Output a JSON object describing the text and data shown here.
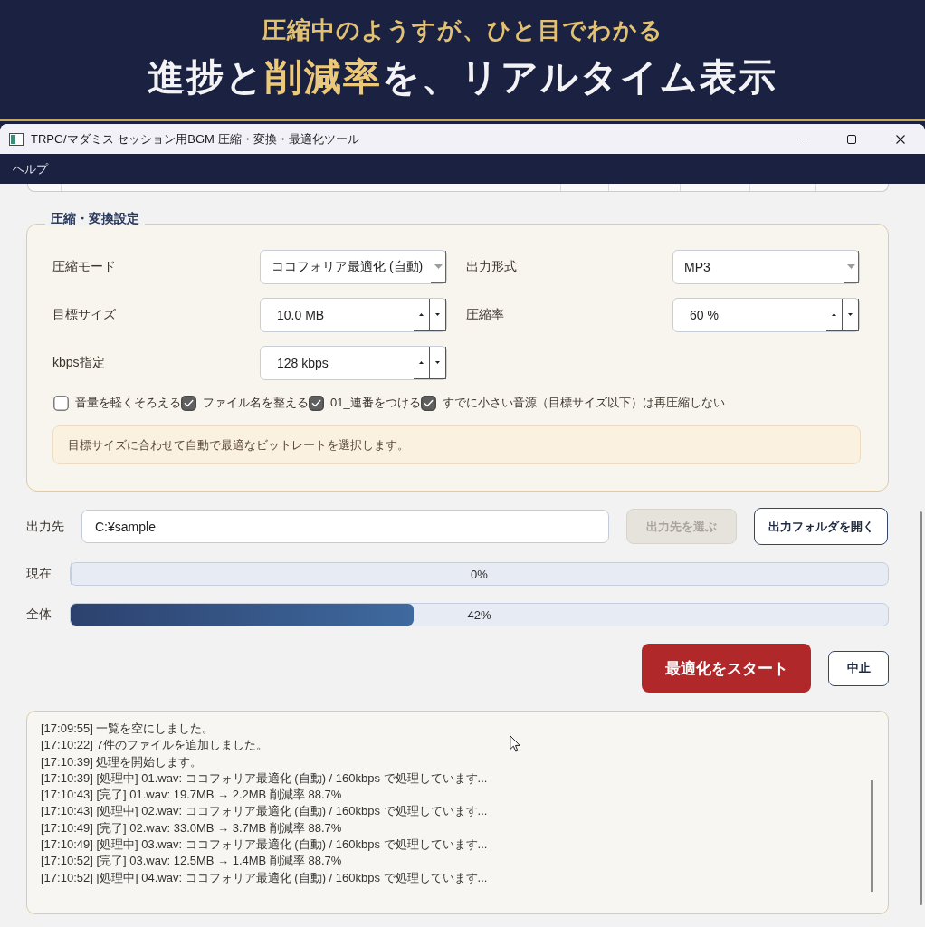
{
  "banner": {
    "subtitle": "圧縮中のようすが、ひと目でわかる",
    "headline": [
      {
        "text": "進捗と",
        "highlight": false
      },
      {
        "text": "削減率",
        "highlight": true
      },
      {
        "text": "を、リアルタイム表示",
        "highlight": false
      }
    ]
  },
  "window": {
    "title": "TRPG/マダミス セッション用BGM 圧縮・変換・最適化ツール"
  },
  "menu_bar": {
    "items": [
      "ヘルプ"
    ]
  },
  "settings": {
    "title": "圧縮・変換設定",
    "fields": [
      {
        "label": "圧縮モード",
        "kind": "combo",
        "value": "ココフォリア最適化 (自動)"
      },
      {
        "label": "出力形式",
        "kind": "combo",
        "value": "MP3"
      },
      {
        "label": "目標サイズ",
        "kind": "spin",
        "value": "10.0 MB"
      },
      {
        "label": "圧縮率",
        "kind": "spin",
        "value": "60 %"
      },
      {
        "label": "kbps指定",
        "kind": "spin",
        "value": "128 kbps"
      }
    ],
    "options": [
      {
        "label": "音量を軽くそろえる",
        "checked": false
      },
      {
        "label": "ファイル名を整える",
        "checked": true
      },
      {
        "label": "01_連番をつける",
        "checked": true
      },
      {
        "label": "すでに小さい音源（目標サイズ以下）は再圧縮しない",
        "checked": true
      }
    ],
    "hint": "目標サイズに合わせて自動で最適なビットレートを選択します。"
  },
  "output": {
    "label": "出力先",
    "value": "C:¥sample",
    "buttons": [
      {
        "label": "出力先を選ぶ",
        "disabled": true
      },
      {
        "label": "出力フォルダを開く",
        "disabled": false
      }
    ]
  },
  "progress": [
    {
      "label": "現在",
      "level": 0,
      "reading": "0%"
    },
    {
      "label": "全体",
      "level": 0.42,
      "reading": "42%"
    }
  ],
  "actions": [
    {
      "label": "最適化をスタート",
      "kind": "primary"
    },
    {
      "label": "中止",
      "kind": "secondary"
    }
  ],
  "log": {
    "lines": [
      "[17:09:55] 一覧を空にしました。",
      "[17:10:22] 7件のファイルを追加しました。",
      "[17:10:39] 処理を開始します。",
      "[17:10:39] [処理中] 01.wav: ココフォリア最適化 (自動) / 160kbps で処理しています...",
      "[17:10:43] [完了] 01.wav: 19.7MB → 2.2MB 削減率 88.7%",
      "[17:10:43] [処理中] 02.wav: ココフォリア最適化 (自動) / 160kbps で処理しています...",
      "[17:10:49] [完了] 02.wav: 33.0MB → 3.7MB 削減率 88.7%",
      "[17:10:49] [処理中] 03.wav: ココフォリア最適化 (自動) / 160kbps で処理しています...",
      "[17:10:52] [完了] 03.wav: 12.5MB → 1.4MB 削減率 88.7%",
      "[17:10:52] [処理中] 04.wav: ココフォリア最適化 (自動) / 160kbps で処理しています..."
    ]
  }
}
